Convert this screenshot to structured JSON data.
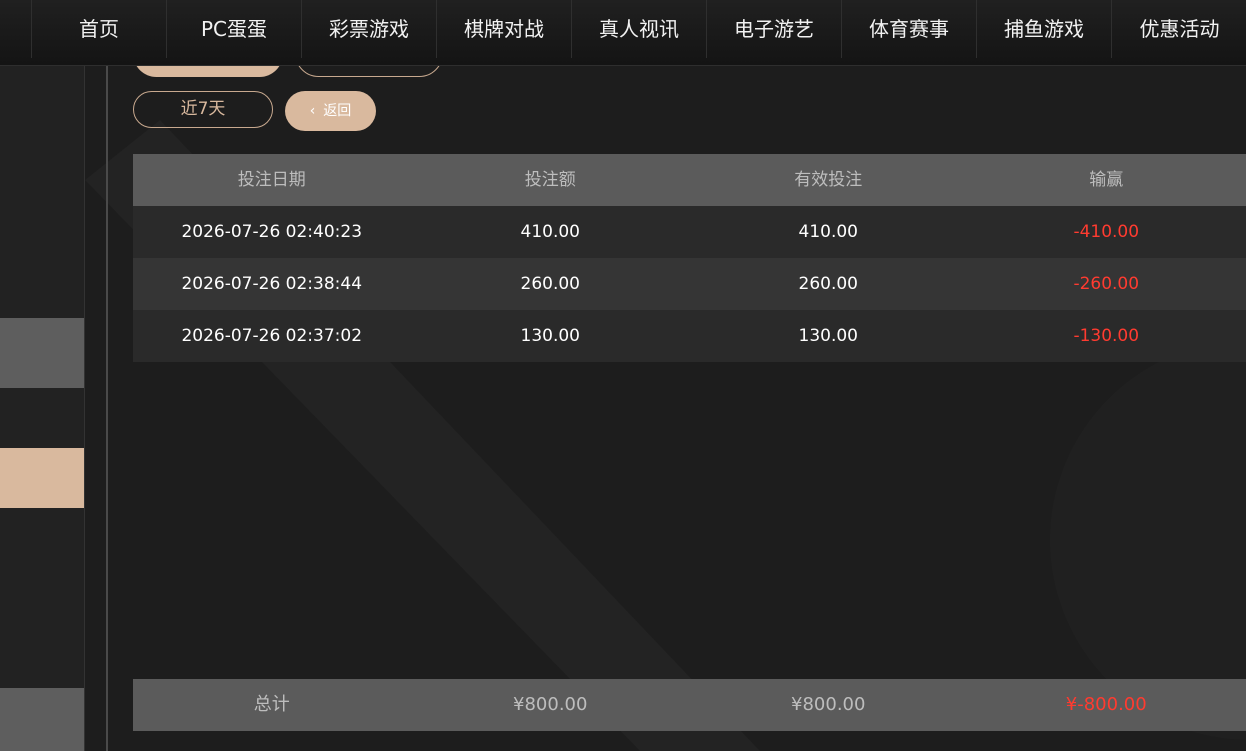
{
  "nav": {
    "items": [
      {
        "label": "首页"
      },
      {
        "label": "PC蛋蛋"
      },
      {
        "label": "彩票游戏"
      },
      {
        "label": "棋牌对战"
      },
      {
        "label": "真人视讯"
      },
      {
        "label": "电子游艺"
      },
      {
        "label": "体育赛事"
      },
      {
        "label": "捕鱼游戏"
      },
      {
        "label": "优惠活动"
      }
    ]
  },
  "filters": {
    "last7days_label": "近7天",
    "back_label": "返回"
  },
  "table": {
    "headers": [
      "投注日期",
      "投注额",
      "有效投注",
      "输赢"
    ],
    "rows": [
      {
        "date": "2026-07-26 02:40:23",
        "bet": "410.00",
        "valid": "410.00",
        "winloss": "-410.00"
      },
      {
        "date": "2026-07-26 02:38:44",
        "bet": "260.00",
        "valid": "260.00",
        "winloss": "-260.00"
      },
      {
        "date": "2026-07-26 02:37:02",
        "bet": "130.00",
        "valid": "130.00",
        "winloss": "-130.00"
      }
    ]
  },
  "total": {
    "label": "总计",
    "bet": "¥800.00",
    "valid": "¥800.00",
    "winloss": "¥-800.00"
  },
  "colors": {
    "accent": "#d9b99e",
    "negative": "#ff3b30",
    "header_bg": "#5b5b5b"
  }
}
